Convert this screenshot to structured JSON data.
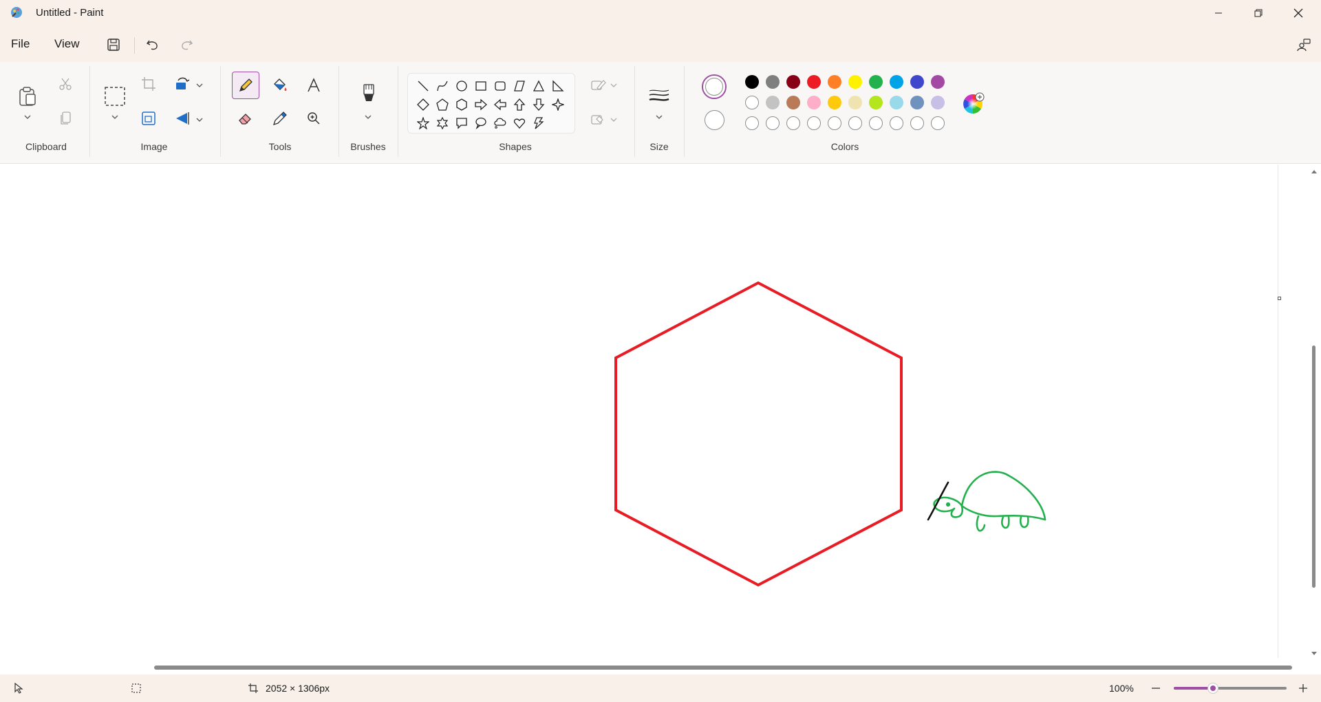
{
  "window": {
    "title": "Untitled - Paint"
  },
  "menu": {
    "file": "File",
    "view": "View"
  },
  "groups": {
    "clipboard": "Clipboard",
    "image": "Image",
    "tools": "Tools",
    "brushes": "Brushes",
    "shapes": "Shapes",
    "size": "Size",
    "colors": "Colors"
  },
  "colors": {
    "accent": "#9f4fa3",
    "palette_row1": [
      "#000000",
      "#7f7f7f",
      "#880015",
      "#ed1c24",
      "#ff7f27",
      "#fff200",
      "#22b14c",
      "#00a2e8",
      "#3f48cc",
      "#a349a4"
    ],
    "palette_row2": [
      "#ffffff",
      "#c3c3c3",
      "#b97a57",
      "#ffaec9",
      "#ffc90e",
      "#efe4b0",
      "#b5e61d",
      "#99d9ea",
      "#7092be",
      "#c8bfe7"
    ],
    "custom_slots": 10,
    "primary": "#ffffff",
    "secondary": "#ffffff",
    "hexagon_stroke": "#e81c24",
    "turtle_stroke": "#22b14c"
  },
  "status": {
    "canvas_size": "2052 × 1306px",
    "zoom": "100%",
    "zoom_level": 0.35
  }
}
